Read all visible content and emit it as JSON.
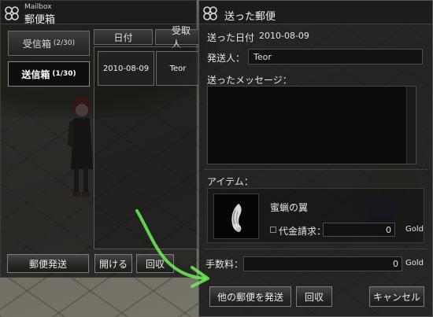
{
  "mailbox": {
    "title_en": "Mailbox",
    "title_jp": "郵便箱",
    "tabs": [
      {
        "label": "受信箱",
        "count": "(2/30)"
      },
      {
        "label": "送信箱",
        "count": "(1/30)"
      }
    ],
    "columns": [
      "日付",
      "受取人"
    ],
    "rows": [
      {
        "date": "2010-08-09",
        "recipient": "Teor"
      }
    ],
    "buttons": {
      "send": "郵便発送",
      "open": "開ける",
      "retrieve": "回収"
    }
  },
  "sent_mail": {
    "title": "送った郵便",
    "sent_date_label": "送った日付",
    "sent_date": "2010-08-09",
    "sender_label": "発送人：",
    "sender": "Teor",
    "message_label": "送ったメッセージ：",
    "message": "",
    "item_label": "アイテム：",
    "item_name": "蜜蝋の翼",
    "cod_label": "代金請求：",
    "cod_value": "0",
    "cod_unit": "Gold",
    "fee_label": "手数料：",
    "fee_value": "0",
    "fee_unit": "Gold",
    "buttons": {
      "send_other": "他の郵便を発送",
      "retrieve": "回収",
      "cancel": "キャンセル"
    }
  },
  "colors": {
    "window_bg": "#181818",
    "border": "#7a7a7a",
    "annotation_arrow": "#6ff05a"
  }
}
